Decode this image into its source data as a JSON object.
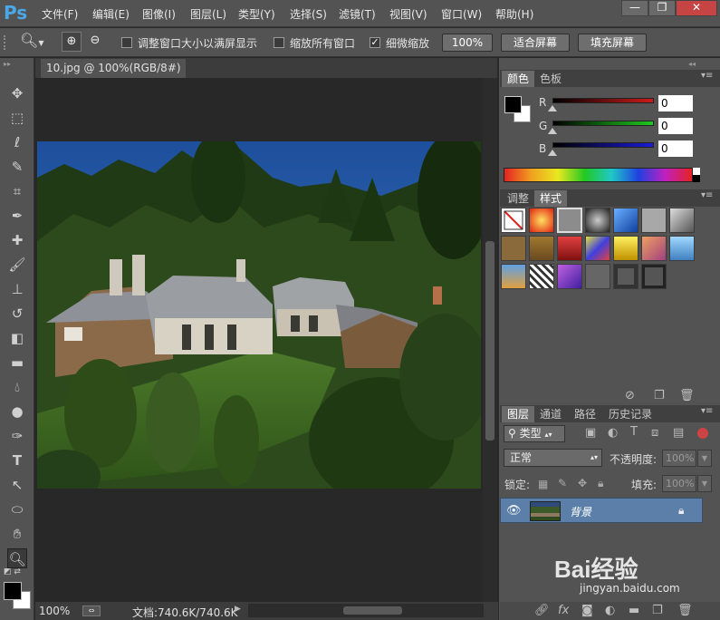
{
  "app": {
    "logo": "Ps"
  },
  "menu": [
    "文件(F)",
    "编辑(E)",
    "图像(I)",
    "图层(L)",
    "类型(Y)",
    "选择(S)",
    "滤镜(T)",
    "视图(V)",
    "窗口(W)",
    "帮助(H)"
  ],
  "window_controls": {
    "minimize": "—",
    "restore": "❐",
    "close": "✕"
  },
  "options": {
    "resize_windows_label": "调整窗口大小以满屏显示",
    "resize_windows_checked": false,
    "zoom_all_label": "缩放所有窗口",
    "zoom_all_checked": false,
    "scrubby_zoom_label": "细微缩放",
    "scrubby_zoom_checked": true,
    "btn_100": "100%",
    "btn_fit": "适合屏幕",
    "btn_fill": "填充屏幕"
  },
  "document": {
    "tab_title": "10.jpg @ 100%(RGB/8#)",
    "close": "×",
    "zoom": "100%",
    "doc_info": "文档:740.6K/740.6K"
  },
  "color_panel": {
    "tabs": [
      "颜色",
      "色板"
    ],
    "channels": [
      {
        "label": "R",
        "value": "0",
        "color": "#cc1b1b"
      },
      {
        "label": "G",
        "value": "0",
        "color": "#1ec91e"
      },
      {
        "label": "B",
        "value": "0",
        "color": "#1b1bd6"
      }
    ]
  },
  "styles_panel": {
    "tabs": [
      "调整",
      "样式"
    ]
  },
  "layers_panel": {
    "tabs": [
      "图层",
      "通道",
      "路径",
      "历史记录"
    ],
    "filter_label": "类型",
    "blend_mode": "正常",
    "opacity_label": "不透明度:",
    "opacity_value": "100%",
    "lock_label": "锁定:",
    "fill_label": "填充:",
    "fill_value": "100%",
    "layer_name": "背景"
  },
  "watermark": {
    "brand": "Bai经验",
    "url": "jingyan.baidu.com"
  }
}
